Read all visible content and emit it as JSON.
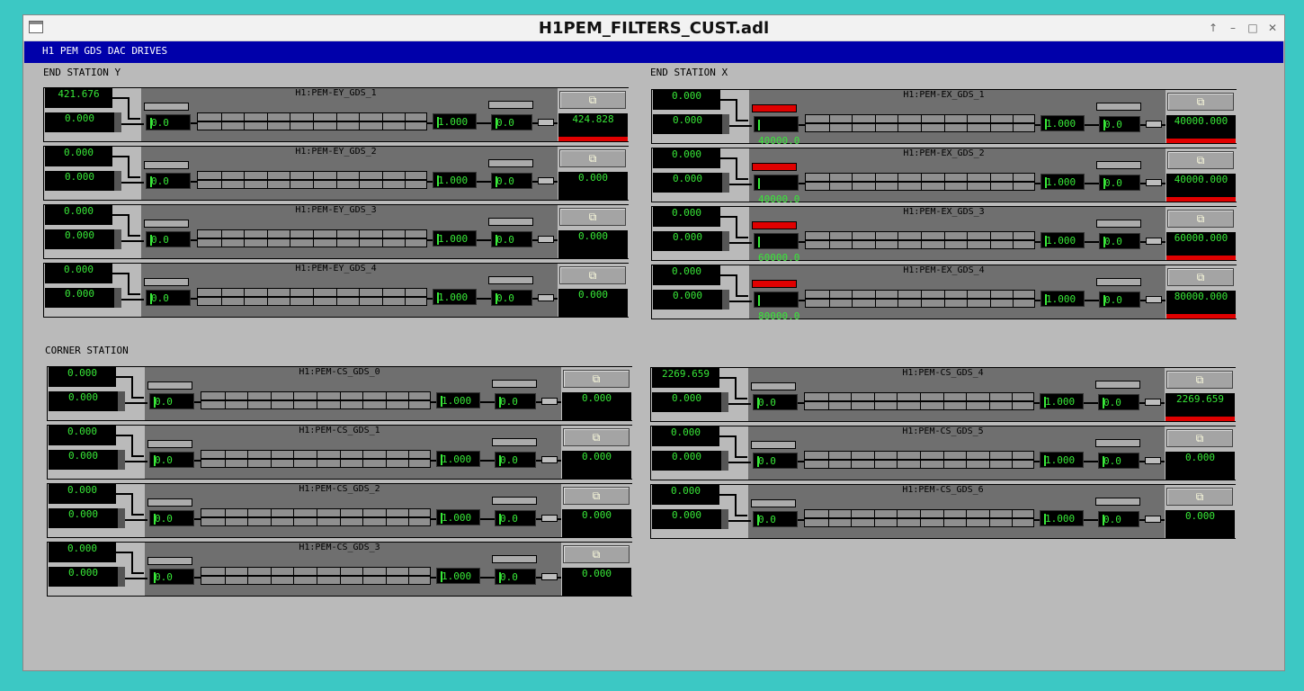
{
  "window": {
    "title": "H1PEM_FILTERS_CUST.adl",
    "controls": [
      "↑",
      "–",
      "□",
      "✕"
    ]
  },
  "banner": "H1 PEM GDS DAC DRIVES",
  "sections": {
    "end_y": "END STATION Y",
    "end_x": "END STATION X",
    "corner": "CORNER STATION"
  },
  "icons": {
    "copy": "⧉"
  },
  "filters": [
    {
      "name": "H1:PEM-EY_GDS_1",
      "top": "421.676",
      "in": "0.000",
      "offset": "0.0",
      "gain": "1.000",
      "limit": "0.0",
      "out": "424.828",
      "red_btn": false,
      "alarm": true
    },
    {
      "name": "H1:PEM-EY_GDS_2",
      "top": "0.000",
      "in": "0.000",
      "offset": "0.0",
      "gain": "1.000",
      "limit": "0.0",
      "out": "0.000",
      "red_btn": false,
      "alarm": false
    },
    {
      "name": "H1:PEM-EY_GDS_3",
      "top": "0.000",
      "in": "0.000",
      "offset": "0.0",
      "gain": "1.000",
      "limit": "0.0",
      "out": "0.000",
      "red_btn": false,
      "alarm": false
    },
    {
      "name": "H1:PEM-EY_GDS_4",
      "top": "0.000",
      "in": "0.000",
      "offset": "0.0",
      "gain": "1.000",
      "limit": "0.0",
      "out": "0.000",
      "red_btn": false,
      "alarm": false
    },
    {
      "name": "H1:PEM-EX_GDS_1",
      "top": "0.000",
      "in": "0.000",
      "offset": "40000.0",
      "gain": "1.000",
      "limit": "0.0",
      "out": "40000.000",
      "red_btn": true,
      "alarm": true
    },
    {
      "name": "H1:PEM-EX_GDS_2",
      "top": "0.000",
      "in": "0.000",
      "offset": "40000.0",
      "gain": "1.000",
      "limit": "0.0",
      "out": "40000.000",
      "red_btn": true,
      "alarm": true
    },
    {
      "name": "H1:PEM-EX_GDS_3",
      "top": "0.000",
      "in": "0.000",
      "offset": "60000.0",
      "gain": "1.000",
      "limit": "0.0",
      "out": "60000.000",
      "red_btn": true,
      "alarm": true
    },
    {
      "name": "H1:PEM-EX_GDS_4",
      "top": "0.000",
      "in": "0.000",
      "offset": "80000.0",
      "gain": "1.000",
      "limit": "0.0",
      "out": "80000.000",
      "red_btn": true,
      "alarm": true
    },
    {
      "name": "H1:PEM-CS_GDS_0",
      "top": "0.000",
      "in": "0.000",
      "offset": "0.0",
      "gain": "1.000",
      "limit": "0.0",
      "out": "0.000",
      "red_btn": false,
      "alarm": false
    },
    {
      "name": "H1:PEM-CS_GDS_1",
      "top": "0.000",
      "in": "0.000",
      "offset": "0.0",
      "gain": "1.000",
      "limit": "0.0",
      "out": "0.000",
      "red_btn": false,
      "alarm": false
    },
    {
      "name": "H1:PEM-CS_GDS_2",
      "top": "0.000",
      "in": "0.000",
      "offset": "0.0",
      "gain": "1.000",
      "limit": "0.0",
      "out": "0.000",
      "red_btn": false,
      "alarm": false
    },
    {
      "name": "H1:PEM-CS_GDS_3",
      "top": "0.000",
      "in": "0.000",
      "offset": "0.0",
      "gain": "1.000",
      "limit": "0.0",
      "out": "0.000",
      "red_btn": false,
      "alarm": false
    },
    {
      "name": "H1:PEM-CS_GDS_4",
      "top": "2269.659",
      "in": "0.000",
      "offset": "0.0",
      "gain": "1.000",
      "limit": "0.0",
      "out": "2269.659",
      "red_btn": false,
      "alarm": true
    },
    {
      "name": "H1:PEM-CS_GDS_5",
      "top": "0.000",
      "in": "0.000",
      "offset": "0.0",
      "gain": "1.000",
      "limit": "0.0",
      "out": "0.000",
      "red_btn": false,
      "alarm": false
    },
    {
      "name": "H1:PEM-CS_GDS_6",
      "top": "0.000",
      "in": "0.000",
      "offset": "0.0",
      "gain": "1.000",
      "limit": "0.0",
      "out": "0.000",
      "red_btn": false,
      "alarm": false
    }
  ]
}
